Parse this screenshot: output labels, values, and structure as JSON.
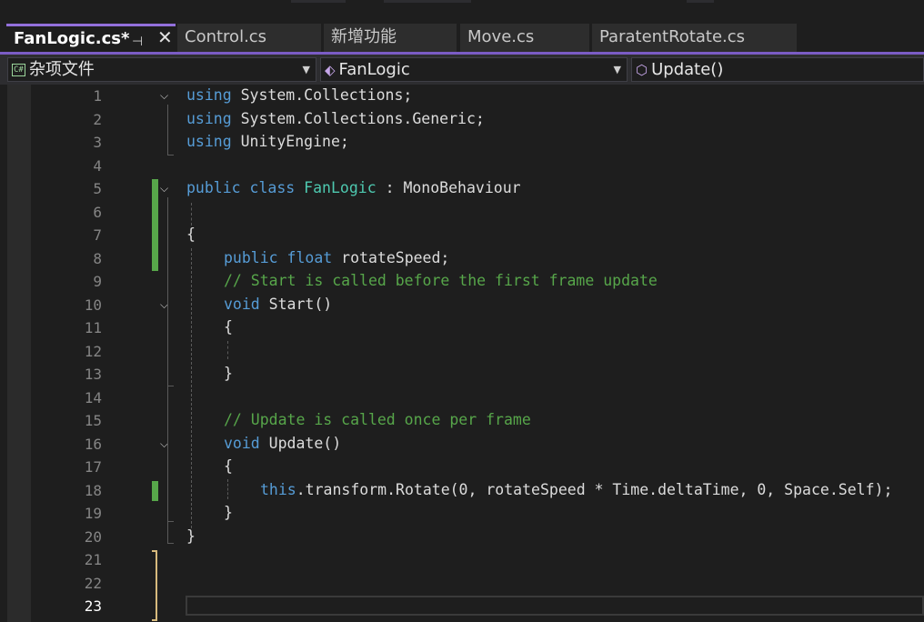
{
  "tabs": [
    {
      "label": "FanLogic.cs*",
      "active": true
    },
    {
      "label": "Control.cs",
      "active": false
    },
    {
      "label": "新增功能",
      "active": false
    },
    {
      "label": "Move.cs",
      "active": false
    },
    {
      "label": "ParatentRotate.cs",
      "active": false
    }
  ],
  "nav": {
    "project": "杂项文件",
    "class_name": "FanLogic",
    "member": "Update()",
    "project_icon": "C#"
  },
  "editor": {
    "line_numbers": [
      "1",
      "2",
      "3",
      "4",
      "5",
      "6",
      "7",
      "8",
      "9",
      "10",
      "11",
      "12",
      "13",
      "14",
      "15",
      "16",
      "17",
      "18",
      "19",
      "20",
      "21",
      "22",
      "23"
    ],
    "current_line": "23"
  },
  "code": {
    "l1": {
      "kw": "using",
      "rest": " System.Collections;"
    },
    "l2": {
      "kw": "using",
      "rest": " System.Collections.Generic;"
    },
    "l3": {
      "kw": "using",
      "rest": " UnityEngine;"
    },
    "l5": {
      "kw1": "public",
      "kw2": "class",
      "cls": "FanLogic",
      "rest": " : MonoBehaviour"
    },
    "l7": "{",
    "l8": {
      "kw1": "public",
      "kw2": "float",
      "rest": " rotateSpeed;"
    },
    "l9": "// Start is called before the first frame update",
    "l10": {
      "kw": "void",
      "rest": " Start()"
    },
    "l11": "{",
    "l13": "}",
    "l15": "// Update is called once per frame",
    "l16": {
      "kw": "void",
      "rest": " Update()"
    },
    "l17": "{",
    "l18": {
      "kw": "this",
      "rest": ".transform.Rotate(0, rotateSpeed * Time.deltaTime, 0, Space.Self);"
    },
    "l19": "}",
    "l20": "}"
  }
}
